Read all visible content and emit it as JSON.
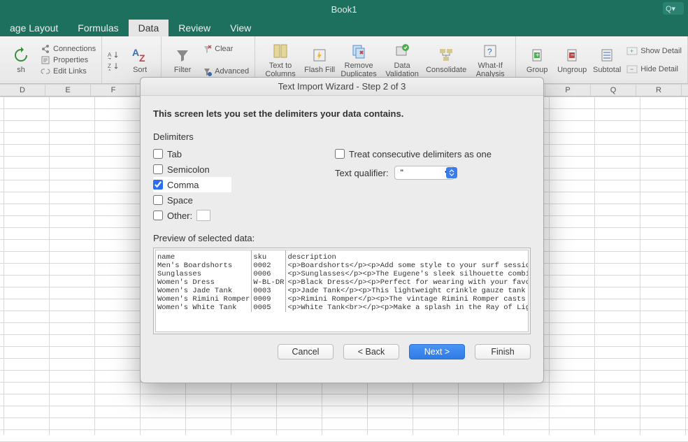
{
  "window": {
    "title": "Book1",
    "search_glyph": "Q▾"
  },
  "tabs": [
    {
      "label": "age Layout",
      "active": false
    },
    {
      "label": "Formulas",
      "active": false
    },
    {
      "label": "Data",
      "active": true
    },
    {
      "label": "Review",
      "active": false
    },
    {
      "label": "View",
      "active": false
    }
  ],
  "ribbon": {
    "refresh_label": "sh",
    "conn": {
      "connections": "Connections",
      "properties": "Properties",
      "edit_links": "Edit Links"
    },
    "sort_label": "Sort",
    "filter_label": "Filter",
    "filter_opts": {
      "clear": "Clear",
      "advanced": "Advanced"
    },
    "text_to_cols": "Text to Columns",
    "flash_fill": "Flash Fill",
    "remove_dup": "Remove Duplicates",
    "data_val": "Data Validation",
    "consolidate": "Consolidate",
    "whatif": "What-If Analysis",
    "group": "Group",
    "ungroup": "Ungroup",
    "subtotal": "Subtotal",
    "show_detail": "Show Detail",
    "hide_detail": "Hide Detail"
  },
  "columns": [
    "D",
    "E",
    "F",
    "",
    "",
    "",
    "",
    "",
    "",
    "",
    "",
    "P",
    "Q",
    "R"
  ],
  "dialog": {
    "title": "Text Import Wizard - Step 2 of 3",
    "instruction": "This screen lets you set the delimiters your data contains.",
    "delim_heading": "Delimiters",
    "tab": "Tab",
    "semicolon": "Semicolon",
    "comma": "Comma",
    "space": "Space",
    "other": "Other:",
    "treat_consecutive": "Treat consecutive delimiters as one",
    "text_qualifier_label": "Text qualifier:",
    "text_qualifier_value": "\"",
    "checked": {
      "tab": false,
      "semicolon": false,
      "comma": true,
      "space": false,
      "other": false,
      "treat": false
    },
    "preview_label": "Preview of selected data:",
    "preview": {
      "cols": [
        "name",
        "sku",
        "description"
      ],
      "rows": [
        [
          "Men's Boardshorts",
          "0002",
          "<p>Boardshorts</p><p>Add some style to your surf sessions with these classic "
        ],
        [
          "Sunglasses",
          "0006",
          "<p>Sunglasses</p><p>The Eugene's sleek silhouette combines a metal rim and br"
        ],
        [
          "Women's Dress",
          "W-BL-DR",
          "<p>Black Dress</p><p>Perfect for wearing with your favorite flat sandals or t"
        ],
        [
          "Women's Jade Tank",
          "0003",
          "<p>Jade Tank</p><p>This lightweight crinkle gauze tank features an allover fl"
        ],
        [
          "Women's Rimini Romper",
          "0009",
          "<p>Rimini Romper</p><p>The vintage Rimini Romper casts a cool and casual vibe"
        ],
        [
          "Women's White Tank",
          "0005",
          "<p>White Tank<br></p><p>Make a splash in the Ray of Light tank. With a croppe"
        ]
      ]
    },
    "buttons": {
      "cancel": "Cancel",
      "back": "< Back",
      "next": "Next >",
      "finish": "Finish"
    }
  }
}
